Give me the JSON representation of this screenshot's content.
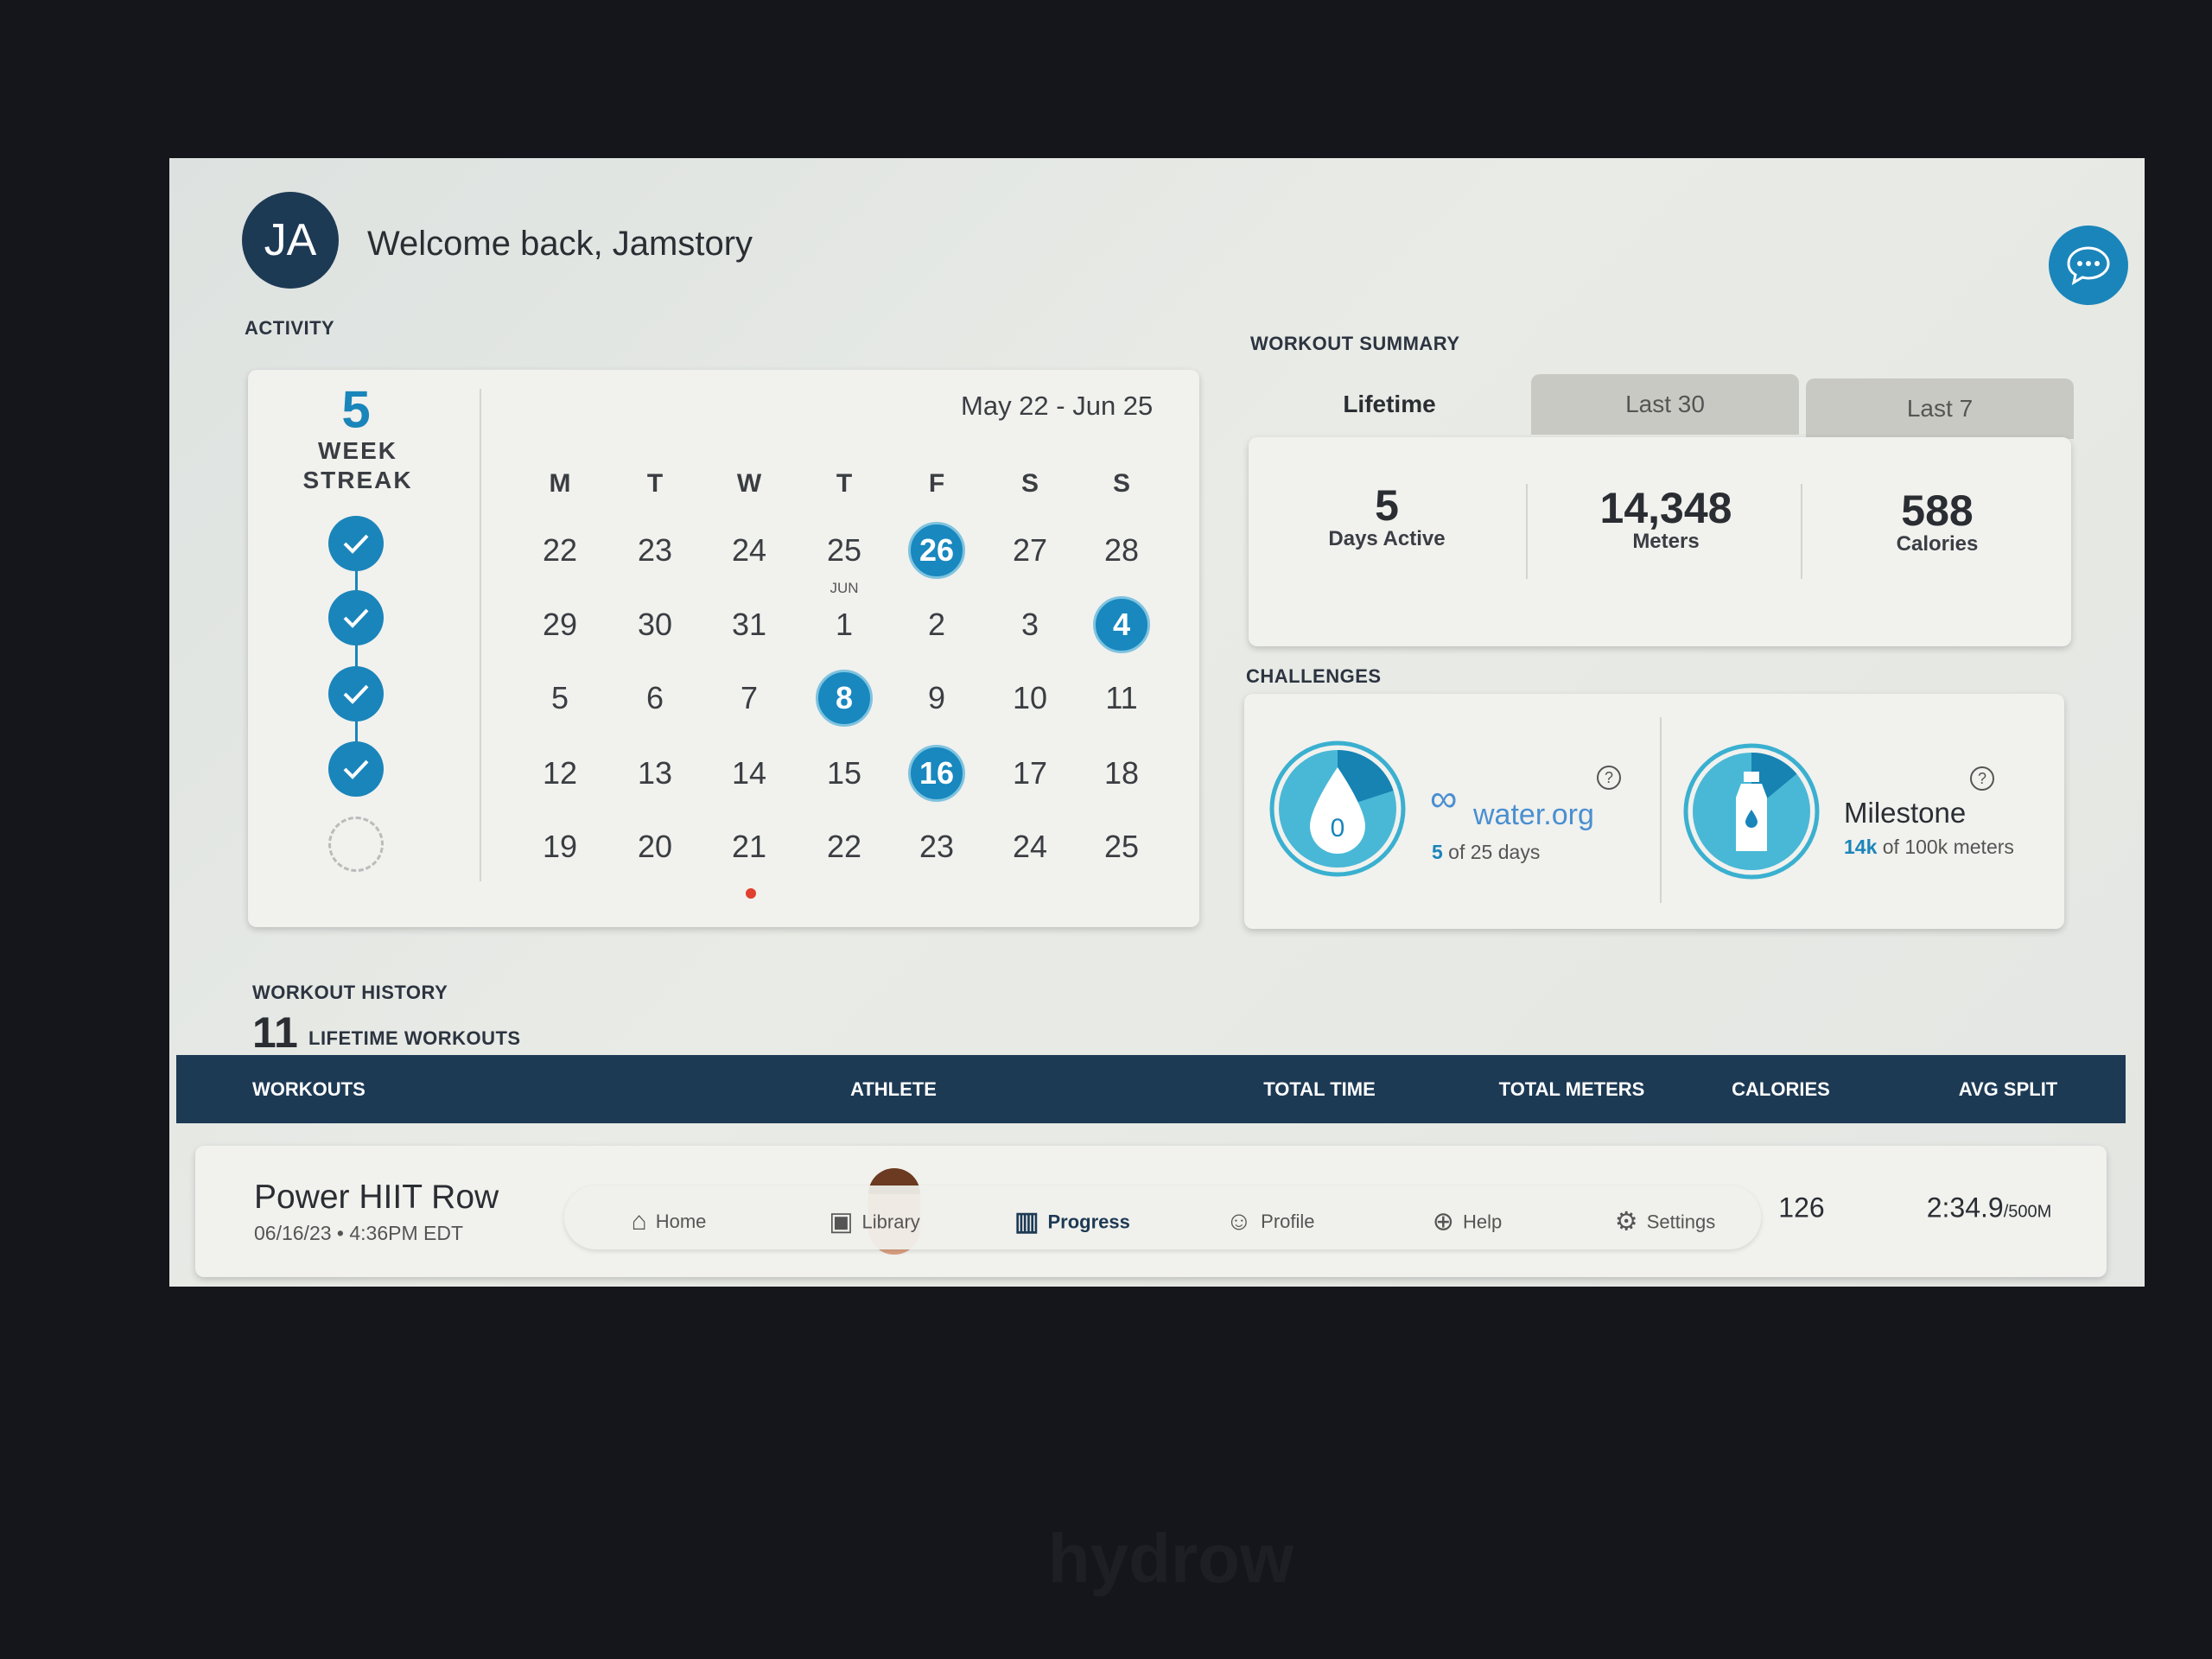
{
  "header": {
    "avatar_initials": "JA",
    "welcome": "Welcome back, Jamstory"
  },
  "activity": {
    "label": "ACTIVITY",
    "streak_value": "5",
    "streak_label_1": "WEEK",
    "streak_label_2": "STREAK",
    "streak_weeks_completed": [
      true,
      true,
      true,
      true,
      false
    ],
    "date_range": "May 22 - Jun 25",
    "weekdays": [
      "M",
      "T",
      "W",
      "T",
      "F",
      "S",
      "S"
    ],
    "month_marker": "JUN",
    "weeks": [
      [
        "22",
        "23",
        "24",
        "25",
        "26",
        "27",
        "28"
      ],
      [
        "29",
        "30",
        "31",
        "1",
        "2",
        "3",
        "4"
      ],
      [
        "5",
        "6",
        "7",
        "8",
        "9",
        "10",
        "11"
      ],
      [
        "12",
        "13",
        "14",
        "15",
        "16",
        "17",
        "18"
      ],
      [
        "19",
        "20",
        "21",
        "22",
        "23",
        "24",
        "25"
      ]
    ],
    "highlighted": [
      "0-4",
      "1-6",
      "2-3",
      "3-4"
    ],
    "today": "4-2"
  },
  "summary": {
    "label": "WORKOUT SUMMARY",
    "tabs": [
      "Lifetime",
      "Last 30",
      "Last 7"
    ],
    "active_tab": "Lifetime",
    "stats": [
      {
        "value": "5",
        "label": "Days Active"
      },
      {
        "value": "14,348",
        "label": "Meters"
      },
      {
        "value": "588",
        "label": "Calories"
      }
    ]
  },
  "challenges": {
    "label": "CHALLENGES",
    "water": {
      "logo": "water.org",
      "ring_value": "0",
      "progress": "5",
      "progress_rest": " of 25 days",
      "fraction": 0.2
    },
    "milestone": {
      "title": "Milestone",
      "progress": "14k",
      "progress_rest": " of 100k meters",
      "fraction": 0.14
    }
  },
  "history": {
    "label": "WORKOUT HISTORY",
    "count": "11",
    "count_label": "LIFETIME WORKOUTS",
    "columns": [
      "WORKOUTS",
      "ATHLETE",
      "TOTAL TIME",
      "TOTAL METERS",
      "CALORIES",
      "AVG SPLIT"
    ],
    "row": {
      "name": "Power HIIT Row",
      "date": "06/16/23 • 4:36PM EDT",
      "calories": "126",
      "split": "2:34.9",
      "split_unit": "/500M"
    }
  },
  "nav": {
    "items": [
      "Home",
      "Library",
      "Progress",
      "Profile",
      "Help",
      "Settings"
    ],
    "active": "Progress"
  },
  "brand": "hydrow",
  "colors": {
    "accent": "#1888bf",
    "navy": "#1d3a55"
  }
}
